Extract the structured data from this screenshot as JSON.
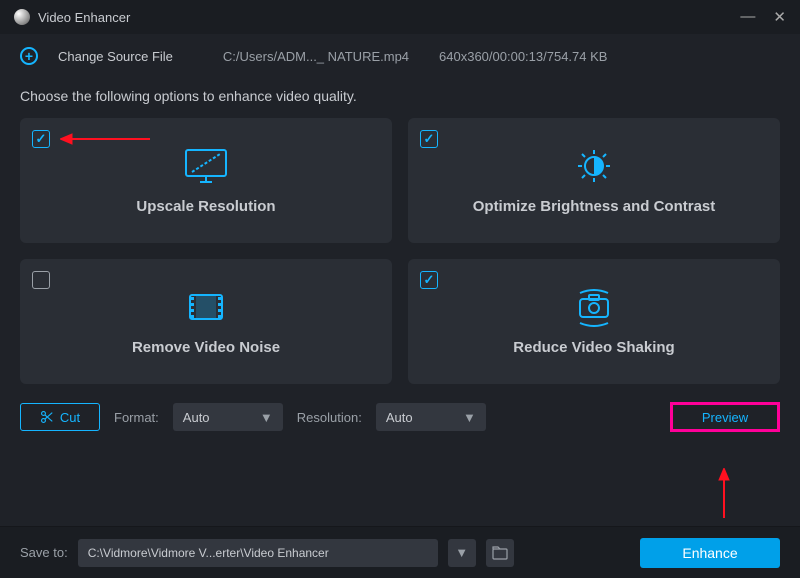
{
  "titlebar": {
    "app_name": "Video Enhancer"
  },
  "toolbar": {
    "change_source": "Change Source File",
    "file_path": "C:/Users/ADM..._ NATURE.mp4",
    "file_meta": "640x360/00:00:13/754.74 KB"
  },
  "instruction": "Choose the following options to enhance video quality.",
  "options": {
    "upscale": {
      "label": "Upscale Resolution",
      "checked": true
    },
    "brightness": {
      "label": "Optimize Brightness and Contrast",
      "checked": true
    },
    "noise": {
      "label": "Remove Video Noise",
      "checked": false
    },
    "shake": {
      "label": "Reduce Video Shaking",
      "checked": true
    }
  },
  "controls": {
    "cut": "Cut",
    "format_label": "Format:",
    "format_value": "Auto",
    "resolution_label": "Resolution:",
    "resolution_value": "Auto",
    "preview": "Preview"
  },
  "footer": {
    "saveto_label": "Save to:",
    "saveto_path": "C:\\Vidmore\\Vidmore V...erter\\Video Enhancer",
    "enhance": "Enhance"
  }
}
